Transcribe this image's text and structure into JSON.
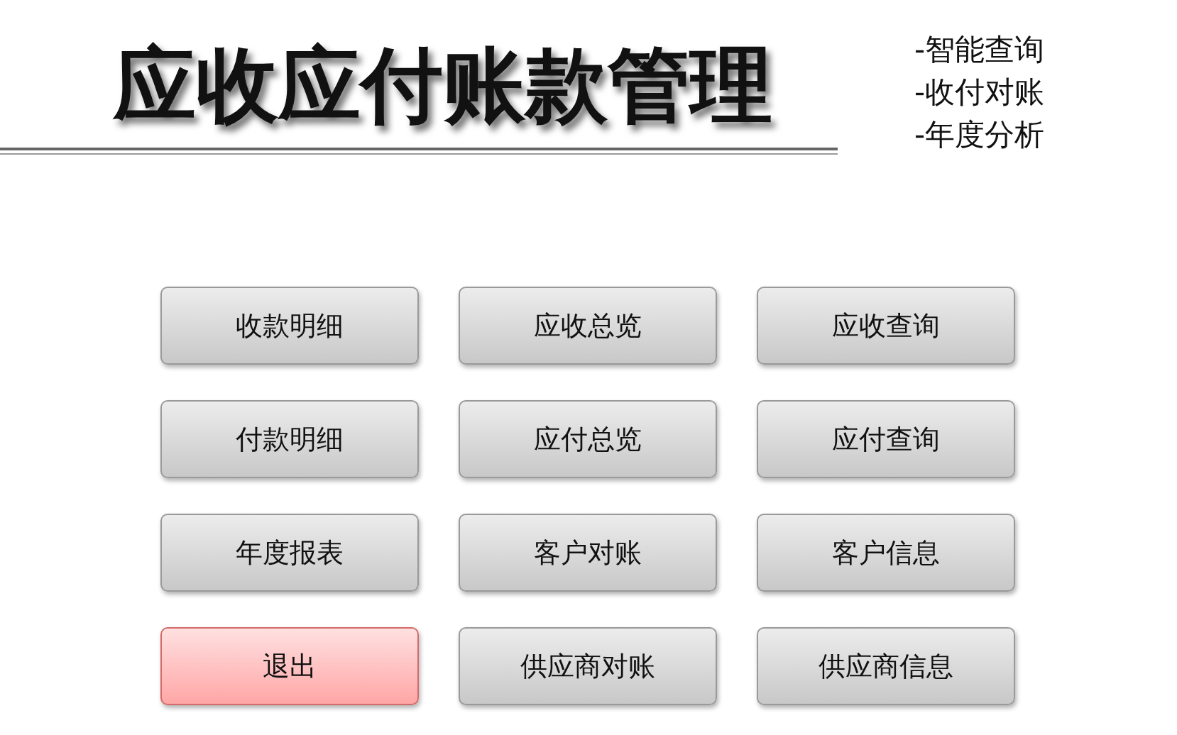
{
  "title": "应收应付账款管理",
  "features": [
    "-智能查询",
    "-收付对账",
    "-年度分析"
  ],
  "buttons": [
    {
      "label": "收款明细",
      "kind": "normal"
    },
    {
      "label": "应收总览",
      "kind": "normal"
    },
    {
      "label": "应收查询",
      "kind": "normal"
    },
    {
      "label": "付款明细",
      "kind": "normal"
    },
    {
      "label": "应付总览",
      "kind": "normal"
    },
    {
      "label": "应付查询",
      "kind": "normal"
    },
    {
      "label": "年度报表",
      "kind": "normal"
    },
    {
      "label": "客户对账",
      "kind": "normal"
    },
    {
      "label": "客户信息",
      "kind": "normal"
    },
    {
      "label": "退出",
      "kind": "exit"
    },
    {
      "label": "供应商对账",
      "kind": "normal"
    },
    {
      "label": "供应商信息",
      "kind": "normal"
    }
  ]
}
